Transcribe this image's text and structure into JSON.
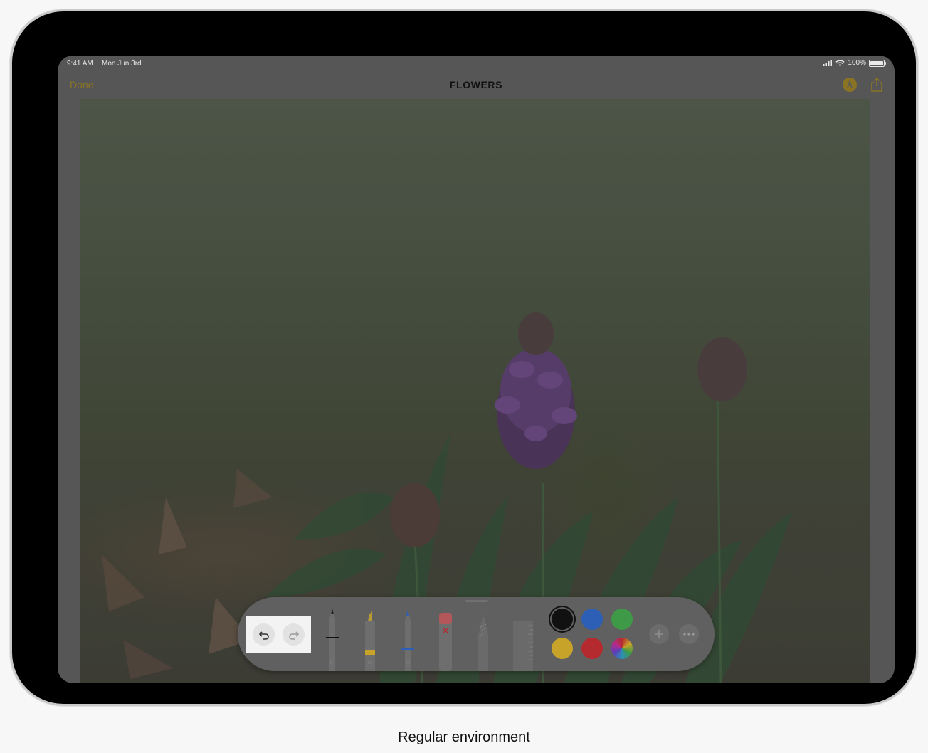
{
  "status_bar": {
    "time": "9:41 AM",
    "date": "Mon Jun 3rd",
    "battery": "100%"
  },
  "nav": {
    "done_label": "Done",
    "title": "FLOWERS"
  },
  "tool_palette": {
    "undo_icon": "undo-arrow-icon",
    "redo_icon": "redo-arrow-icon",
    "tools": [
      {
        "name": "pen",
        "size": "57"
      },
      {
        "name": "marker",
        "size": "80"
      },
      {
        "name": "pencil",
        "size": "50"
      },
      {
        "name": "eraser"
      },
      {
        "name": "lasso"
      },
      {
        "name": "ruler"
      }
    ],
    "colors": [
      "#111111",
      "#2d5fb7",
      "#3e9a47",
      "#c7a32a",
      "#b52a2f",
      "color-wheel"
    ],
    "selected_color": "#111111"
  },
  "colors": {
    "accent": "#8a7424",
    "highlight": "#f3f3f3"
  },
  "caption": "Regular environment"
}
